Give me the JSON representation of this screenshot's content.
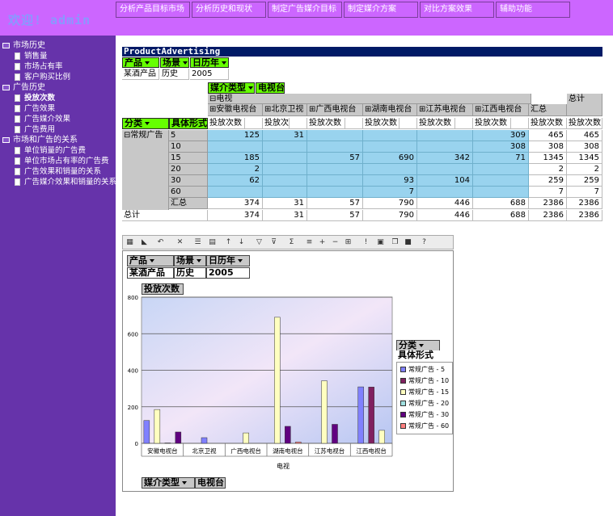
{
  "header": {
    "welcome": "欢迎! admin"
  },
  "topnav": [
    "分析产品目标市场",
    "分析历史和现状",
    "制定广告媒介目标",
    "制定媒介方案",
    "对比方案效果",
    "辅助功能"
  ],
  "sidebar": {
    "groups": [
      {
        "label": "市场历史",
        "items": [
          {
            "label": "销售量",
            "bold": false
          },
          {
            "label": "市场占有率",
            "bold": false
          },
          {
            "label": "客户购买比例",
            "bold": false
          }
        ]
      },
      {
        "label": "广告历史",
        "items": [
          {
            "label": "投放次数",
            "bold": true
          },
          {
            "label": "广告效果",
            "bold": false
          },
          {
            "label": "广告媒介效果",
            "bold": false
          },
          {
            "label": "广告费用",
            "bold": false
          }
        ]
      },
      {
        "label": "市场和广告的关系",
        "items": [
          {
            "label": "单位销量的广告费",
            "bold": false
          },
          {
            "label": "单位市场占有率的广告费",
            "bold": false
          },
          {
            "label": "广告效果和销量的关系",
            "bold": false
          },
          {
            "label": "广告媒介效果和销量的关系",
            "bold": false
          }
        ]
      }
    ]
  },
  "pivot": {
    "title": "ProductAdvertising",
    "filters": [
      {
        "label": "产品",
        "value": "某酒产品"
      },
      {
        "label": "场景",
        "value": "历史"
      },
      {
        "label": "日历年",
        "value": "2005"
      }
    ],
    "column_field": {
      "label": "媒介类型",
      "value": "电视台"
    },
    "column_group": "电视",
    "stations": [
      "安徽电视台",
      "北京卫视",
      "广西电视台",
      "湖南电视台",
      "江苏电视台",
      "江西电视台"
    ],
    "subtotal_label": "汇总",
    "grand_total_label": "总计",
    "row_fields": [
      "分类",
      "具体形式"
    ],
    "measure": "投放次数",
    "category": "常规广告",
    "rows": [
      {
        "form": "5",
        "values": [
          "125",
          "31",
          "",
          "",
          "",
          "309"
        ],
        "subtotal": "465",
        "total": "465"
      },
      {
        "form": "10",
        "values": [
          "",
          "",
          "",
          "",
          "",
          "308"
        ],
        "subtotal": "308",
        "total": "308"
      },
      {
        "form": "15",
        "values": [
          "185",
          "",
          "57",
          "690",
          "342",
          "71"
        ],
        "subtotal": "1345",
        "total": "1345"
      },
      {
        "form": "20",
        "values": [
          "2",
          "",
          "",
          "",
          "",
          ""
        ],
        "subtotal": "2",
        "total": "2"
      },
      {
        "form": "30",
        "values": [
          "62",
          "",
          "",
          "93",
          "104",
          ""
        ],
        "subtotal": "259",
        "total": "259"
      },
      {
        "form": "60",
        "values": [
          "",
          "",
          "",
          "7",
          "",
          ""
        ],
        "subtotal": "7",
        "total": "7"
      }
    ],
    "subtotal_row": {
      "label": "汇总",
      "values": [
        "374",
        "31",
        "57",
        "790",
        "446",
        "688"
      ],
      "subtotal": "2386",
      "total": "2386"
    },
    "total_row": {
      "label": "总计",
      "values": [
        "374",
        "31",
        "57",
        "790",
        "446",
        "688"
      ],
      "subtotal": "2386",
      "total": "2386"
    }
  },
  "chart": {
    "filters": [
      {
        "label": "产品",
        "value": "某酒产品"
      },
      {
        "label": "场景",
        "value": "历史"
      },
      {
        "label": "日历年",
        "value": "2005"
      }
    ],
    "measure_label": "投放次数",
    "legend_field": "分类",
    "legend_field2": "具体形式",
    "axis_field": {
      "label": "媒介类型",
      "value": "电视台"
    },
    "colors": [
      "#8080ff",
      "#802060",
      "#ffffc0",
      "#a0e0e0",
      "#600080",
      "#ff8080"
    ]
  },
  "chart_data": {
    "type": "bar",
    "categories": [
      "安徽电视台",
      "北京卫视",
      "广西电视台",
      "湖南电视台",
      "江苏电视台",
      "江西电视台"
    ],
    "series": [
      {
        "name": "常规广告 - 5",
        "values": [
          125,
          31,
          0,
          0,
          0,
          309
        ]
      },
      {
        "name": "常规广告 - 10",
        "values": [
          0,
          0,
          0,
          0,
          0,
          308
        ]
      },
      {
        "name": "常规广告 - 15",
        "values": [
          185,
          0,
          57,
          690,
          342,
          71
        ]
      },
      {
        "name": "常规广告 - 20",
        "values": [
          2,
          0,
          0,
          0,
          0,
          0
        ]
      },
      {
        "name": "常规广告 - 30",
        "values": [
          62,
          0,
          0,
          93,
          104,
          0
        ]
      },
      {
        "name": "常规广告 - 60",
        "values": [
          0,
          0,
          0,
          7,
          0,
          0
        ]
      }
    ],
    "xlabel": "电视",
    "ylabel": "",
    "ylim": [
      0,
      800
    ],
    "yticks": [
      0,
      200,
      400,
      600,
      800
    ],
    "grid": true,
    "legend": "right"
  }
}
